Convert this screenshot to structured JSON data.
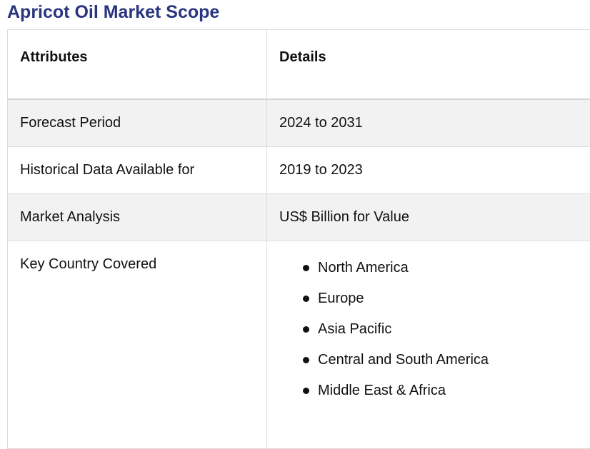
{
  "title": "Apricot Oil Market Scope",
  "table": {
    "headers": [
      "Attributes",
      "Details"
    ],
    "rows": [
      {
        "attribute": "Forecast Period",
        "detail": "2024 to 2031"
      },
      {
        "attribute": "Historical Data Available for",
        "detail": "2019 to 2023"
      },
      {
        "attribute": "Market Analysis",
        "detail": "US$ Billion for Value"
      }
    ],
    "key_country": {
      "attribute": "Key Country Covered",
      "items": [
        "North America",
        "Europe",
        "Asia Pacific",
        "Central and South America",
        "Middle East & Africa"
      ]
    }
  },
  "colors": {
    "title": "#2a3580",
    "row_shade": "#f2f2f2",
    "border": "#dcdcdc"
  }
}
